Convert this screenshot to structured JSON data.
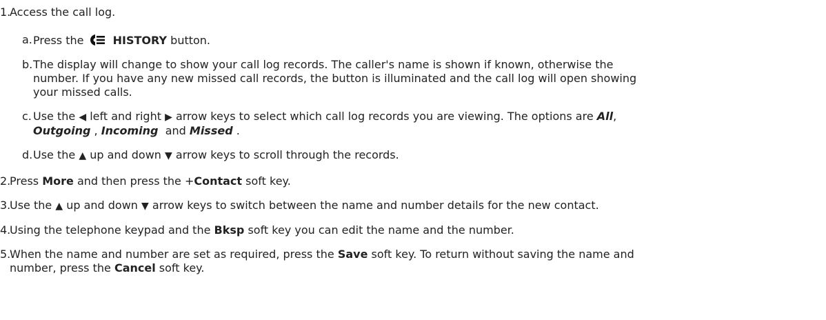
{
  "steps": {
    "s1": {
      "num": "1.",
      "text": "Access the call log."
    },
    "s1a": {
      "num": "a.",
      "pre": "Press the",
      "key": "HISTORY",
      "post": "button."
    },
    "s1b": {
      "num": "b.",
      "line1": "The display will change to show your call log records. The caller's name is shown if known, otherwise the",
      "line2": "number. If you have any new missed call records, the button is illuminated and the call log will open showing",
      "line3": "your missed calls."
    },
    "s1c": {
      "num": "c.",
      "pre": "Use the",
      "mid": "left and right",
      "post": "arrow keys to select which call log records you are viewing. The options are",
      "opt_all": "All",
      "opt_out": "Outgoing",
      "opt_in": "Incoming",
      "and": "and",
      "opt_missed": "Missed"
    },
    "s1d": {
      "num": "d.",
      "pre": "Use the",
      "mid": "up and down",
      "post": "arrow keys to scroll through the records."
    },
    "s2": {
      "num": "2.",
      "pre": "Press",
      "more": "More",
      "mid": "and then press the +",
      "contact": "Contact",
      "post": "soft key."
    },
    "s3": {
      "num": "3.",
      "pre": "Use the",
      "mid": "up and down",
      "post": "arrow keys to switch between the name and number details for the new contact."
    },
    "s4": {
      "num": "4.",
      "pre": "Using the telephone keypad and the",
      "bksp": "Bksp",
      "post": "soft key you can edit the name and the number."
    },
    "s5": {
      "num": "5.",
      "pre": "When the name and number are set as required, press the",
      "save": "Save",
      "mid": "soft key. To return without saving the name and",
      "line2pre": "number, press the",
      "cancel": "Cancel",
      "post": "soft key."
    }
  },
  "glyphs": {
    "left": "◀",
    "right": "▶",
    "up": "▲",
    "down": "▼"
  }
}
